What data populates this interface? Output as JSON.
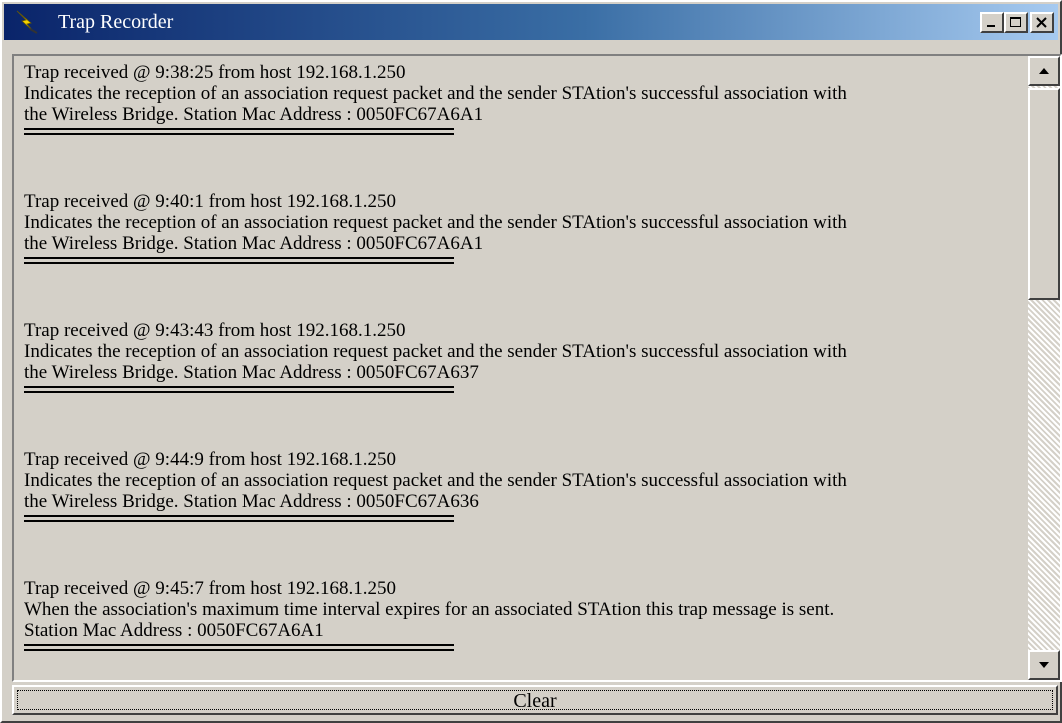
{
  "window": {
    "title": "Trap Recorder",
    "title_icon": "lightning-app-icon"
  },
  "titlebar_buttons": [
    {
      "name": "minimize-button",
      "icon": "minimize-icon"
    },
    {
      "name": "maximize-button",
      "icon": "maximize-icon"
    },
    {
      "name": "close-button",
      "icon": "close-icon"
    }
  ],
  "log": {
    "entries": [
      {
        "lines": [
          "Trap received @ 9:38:25 from host 192.168.1.250",
          "Indicates the reception of an association request packet and the sender STAtion's successful association with",
          "the Wireless Bridge. Station Mac Address : 0050FC67A6A1"
        ]
      },
      {
        "lines": [
          "Trap received @ 9:40:1 from host 192.168.1.250",
          "Indicates the reception of an association request packet and the sender STAtion's successful association with",
          "the Wireless Bridge. Station Mac Address : 0050FC67A6A1"
        ]
      },
      {
        "lines": [
          "Trap received @ 9:43:43 from host 192.168.1.250",
          "Indicates the reception of an association request packet and the sender STAtion's successful association with",
          "the Wireless Bridge. Station Mac Address : 0050FC67A637"
        ]
      },
      {
        "lines": [
          "Trap received @ 9:44:9 from host 192.168.1.250",
          "Indicates the reception of an association request packet and the sender STAtion's successful association with",
          "the Wireless Bridge. Station Mac Address : 0050FC67A636"
        ]
      },
      {
        "lines": [
          "Trap received @ 9:45:7 from host 192.168.1.250",
          "When the association's maximum time interval expires for an associated STAtion this trap message is sent.",
          "Station Mac Address : 0050FC67A6A1"
        ]
      }
    ],
    "scrollbar": {
      "up_icon": "scroll-up-arrow-icon",
      "down_icon": "scroll-down-arrow-icon",
      "position": 0
    }
  },
  "clear_button": {
    "label": "Clear"
  },
  "colors": {
    "face": "#d4d0c8",
    "title_active_start": "#0a246a",
    "title_active_end": "#a6caf0",
    "title_text": "#ffffff"
  }
}
